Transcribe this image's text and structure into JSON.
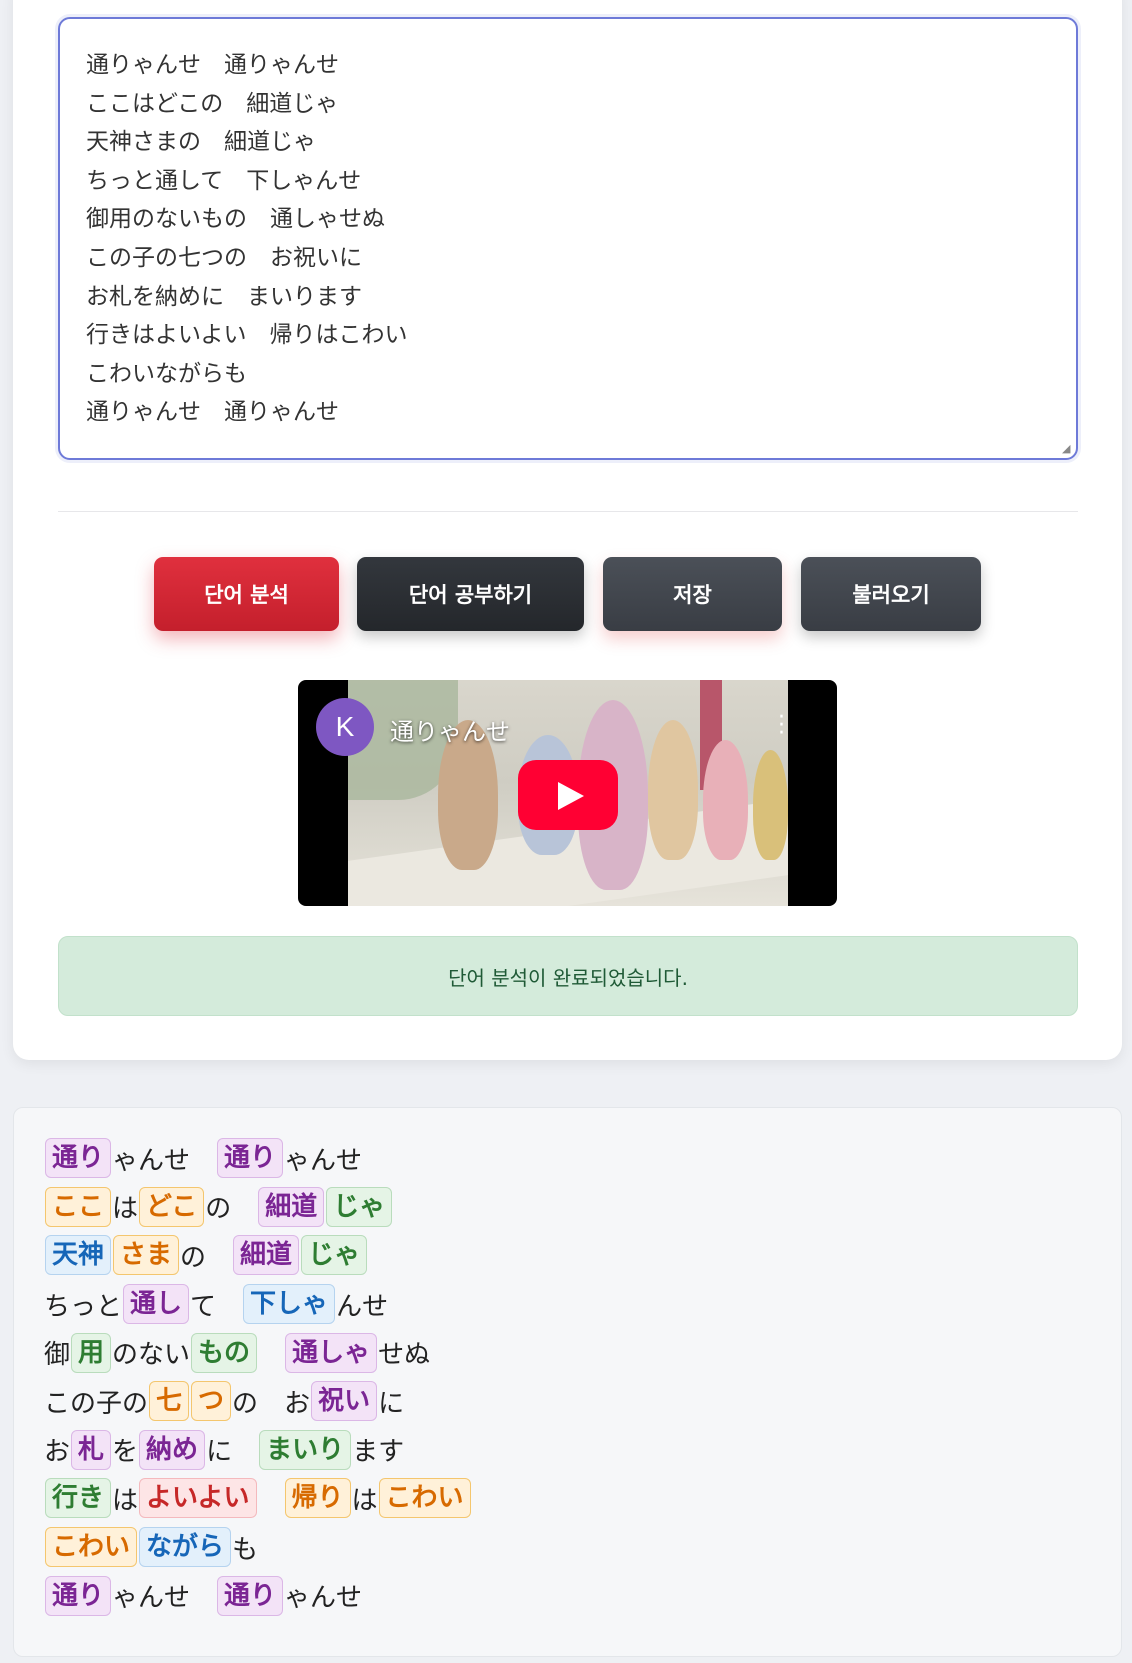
{
  "editor": {
    "lyrics_text": "通りゃんせ　通りゃんせ\nここはどこの　細道じゃ\n天神さまの　細道じゃ\nちっと通して　下しゃんせ\n御用のないもの　通しゃせぬ\nこの子の七つの　お祝いに\nお札を納めに　まいります\n行きはよいよい　帰りはこわい\nこわいながらも\n通りゃんせ　通りゃんせ"
  },
  "buttons": {
    "analyze": "단어 분석",
    "study": "단어 공부하기",
    "save": "저장",
    "load": "불러오기"
  },
  "video": {
    "channel_initial": "K",
    "title": "通りゃんせ"
  },
  "alert": {
    "message": "단어 분석이 완료되었습니다."
  },
  "colors": {
    "accent": "#6e7ad8",
    "analyze_button": "#dc2f3c",
    "success_bg": "#d4ebdb"
  },
  "result_lines": [
    [
      {
        "t": "通り",
        "c": "purple"
      },
      {
        "t": "ゃんせ"
      },
      {
        "gap": true
      },
      {
        "t": "通り",
        "c": "purple"
      },
      {
        "t": "ゃんせ"
      }
    ],
    [
      {
        "t": "ここ",
        "c": "orange"
      },
      {
        "t": "は"
      },
      {
        "t": "どこ",
        "c": "orange"
      },
      {
        "t": "の"
      },
      {
        "gap": true
      },
      {
        "t": "細道",
        "c": "purple"
      },
      {
        "t": "じゃ",
        "c": "green"
      }
    ],
    [
      {
        "t": "天神",
        "c": "blue"
      },
      {
        "t": "さま",
        "c": "orange"
      },
      {
        "t": "の"
      },
      {
        "gap": true
      },
      {
        "t": "細道",
        "c": "purple"
      },
      {
        "t": "じゃ",
        "c": "green"
      }
    ],
    [
      {
        "t": "ちっと"
      },
      {
        "t": "通し",
        "c": "purple"
      },
      {
        "t": "て"
      },
      {
        "gap": true
      },
      {
        "t": "下しゃ",
        "c": "blue"
      },
      {
        "t": "んせ"
      }
    ],
    [
      {
        "t": "御"
      },
      {
        "t": "用",
        "c": "green"
      },
      {
        "t": "のない"
      },
      {
        "t": "もの",
        "c": "green"
      },
      {
        "gap": true
      },
      {
        "t": "通しゃ",
        "c": "purple"
      },
      {
        "t": "せぬ"
      }
    ],
    [
      {
        "t": "この子の"
      },
      {
        "t": "七",
        "c": "orange"
      },
      {
        "t": "つ",
        "c": "orange"
      },
      {
        "t": "の"
      },
      {
        "gap": true
      },
      {
        "t": "お"
      },
      {
        "t": "祝い",
        "c": "purple"
      },
      {
        "t": "に"
      }
    ],
    [
      {
        "t": "お"
      },
      {
        "t": "札",
        "c": "purple"
      },
      {
        "t": "を"
      },
      {
        "t": "納め",
        "c": "purple"
      },
      {
        "t": "に"
      },
      {
        "gap": true
      },
      {
        "t": "まいり",
        "c": "green"
      },
      {
        "t": "ます"
      }
    ],
    [
      {
        "t": "行き",
        "c": "green"
      },
      {
        "t": "は"
      },
      {
        "t": "よいよい",
        "c": "red"
      },
      {
        "gap": true
      },
      {
        "t": "帰り",
        "c": "orange"
      },
      {
        "t": "は"
      },
      {
        "t": "こわい",
        "c": "orange"
      }
    ],
    [
      {
        "t": "こわい",
        "c": "orange"
      },
      {
        "t": "ながら",
        "c": "blue"
      },
      {
        "t": "も"
      }
    ],
    [
      {
        "t": "通り",
        "c": "purple"
      },
      {
        "t": "ゃんせ"
      },
      {
        "gap": true
      },
      {
        "t": "通り",
        "c": "purple"
      },
      {
        "t": "ゃんせ"
      }
    ]
  ]
}
